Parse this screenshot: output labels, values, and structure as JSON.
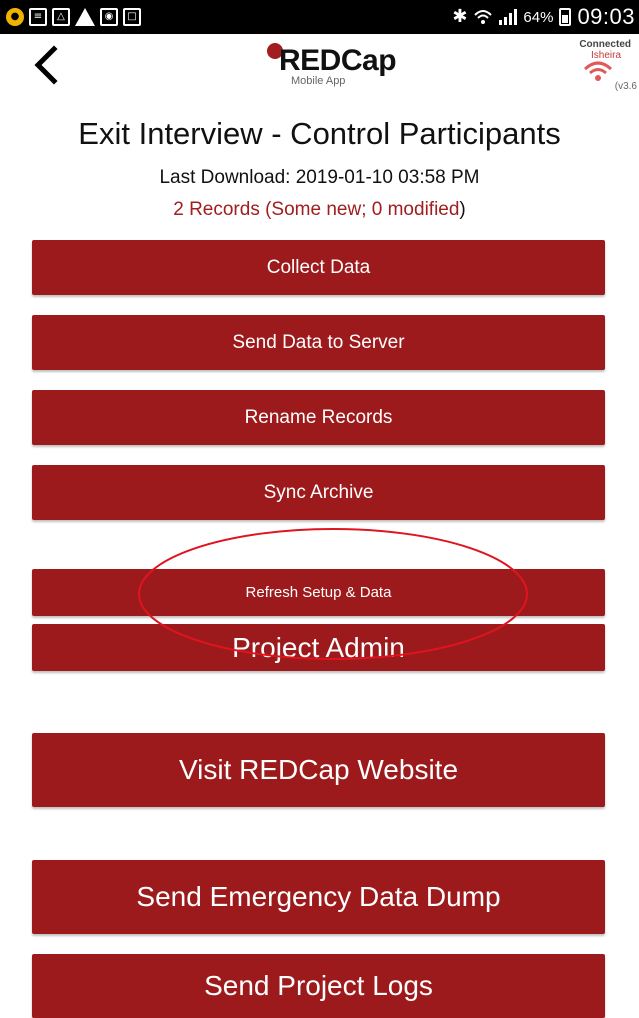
{
  "status_bar": {
    "battery": "64%",
    "time": "09:03",
    "icons": [
      "lock-icon",
      "file-icon",
      "image-icon",
      "warning-icon",
      "app-icon",
      "mail-icon",
      "bluetooth-icon",
      "wifi-icon",
      "signal-icon",
      "battery-icon"
    ]
  },
  "header": {
    "logo_text": "REDCap",
    "logo_subtitle": "Mobile App",
    "connection_label": "Connected",
    "network_name": "Isheira",
    "version": "(v3.6"
  },
  "project": {
    "title": "Exit Interview - Control Participants",
    "last_download": "Last Download: 2019-01-10 03:58 PM",
    "records_count": "2 Records (Some new; 0 modified",
    "records_close": ")"
  },
  "buttons": {
    "collect_data": "Collect Data",
    "send_data": "Send Data to Server",
    "rename_records": "Rename Records",
    "sync_archive": "Sync Archive",
    "refresh_setup": "Refresh Setup & Data",
    "project_admin": "Project Admin",
    "visit_website": "Visit REDCap Website",
    "emergency_dump": "Send Emergency Data Dump",
    "project_logs": "Send Project Logs"
  },
  "colors": {
    "brand_red": "#9d1a1c",
    "annotation_red": "#e0141e",
    "status_bar_bg": "#000000"
  }
}
